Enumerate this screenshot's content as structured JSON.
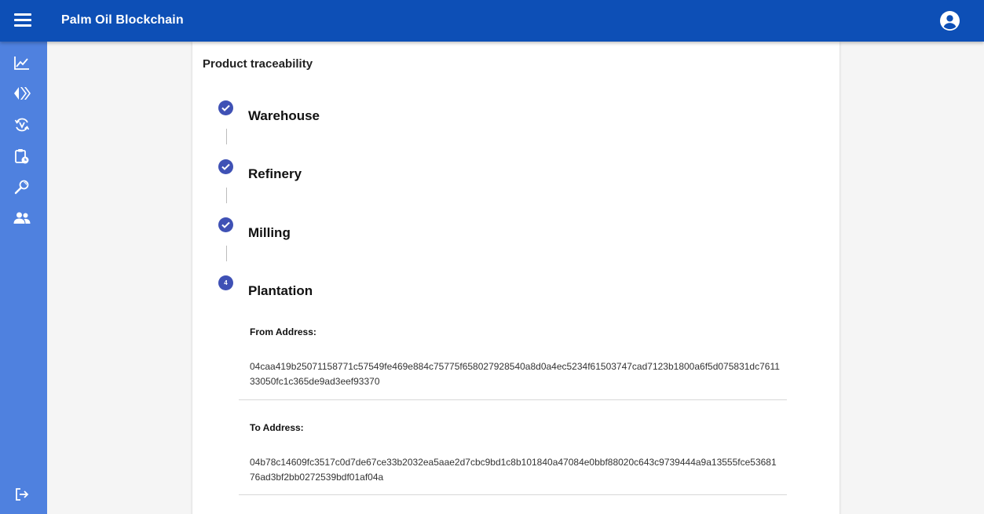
{
  "app": {
    "title": "Palm Oil Blockchain"
  },
  "colors": {
    "appbar": "#0d4fb6",
    "sidebar": "#4f81df",
    "step_icon": "#3f51b5"
  },
  "sidebar": {
    "items": [
      {
        "icon": "chart-line-icon"
      },
      {
        "icon": "transfer-arrows-icon"
      },
      {
        "icon": "verified-cycle-icon"
      },
      {
        "icon": "clipboard-clock-icon"
      },
      {
        "icon": "search-magnifier-icon"
      },
      {
        "icon": "users-icon"
      }
    ],
    "footer_icon": "logout-icon"
  },
  "card": {
    "title": "Product traceability",
    "steps": [
      {
        "label": "Warehouse",
        "status": "completed"
      },
      {
        "label": "Refinery",
        "status": "completed"
      },
      {
        "label": "Milling",
        "status": "completed"
      },
      {
        "label": "Plantation",
        "status": "active",
        "number": "4"
      }
    ],
    "details": {
      "from_label": "From Address:",
      "from_value": "04caa419b25071158771c57549fe469e884c75775f658027928540a8d0a4ec5234f61503747cad7123b1800a6f5d075831dc761133050fc1c365de9ad3eef93370",
      "to_label": "To Address:",
      "to_value": "04b78c14609fc3517c0d7de67ce33b2032ea5aae2d7cbc9bd1c8b101840a47084e0bbf88020c643c9739444a9a13555fce5368176ad3bf2bb0272539bdf01af04a"
    }
  }
}
